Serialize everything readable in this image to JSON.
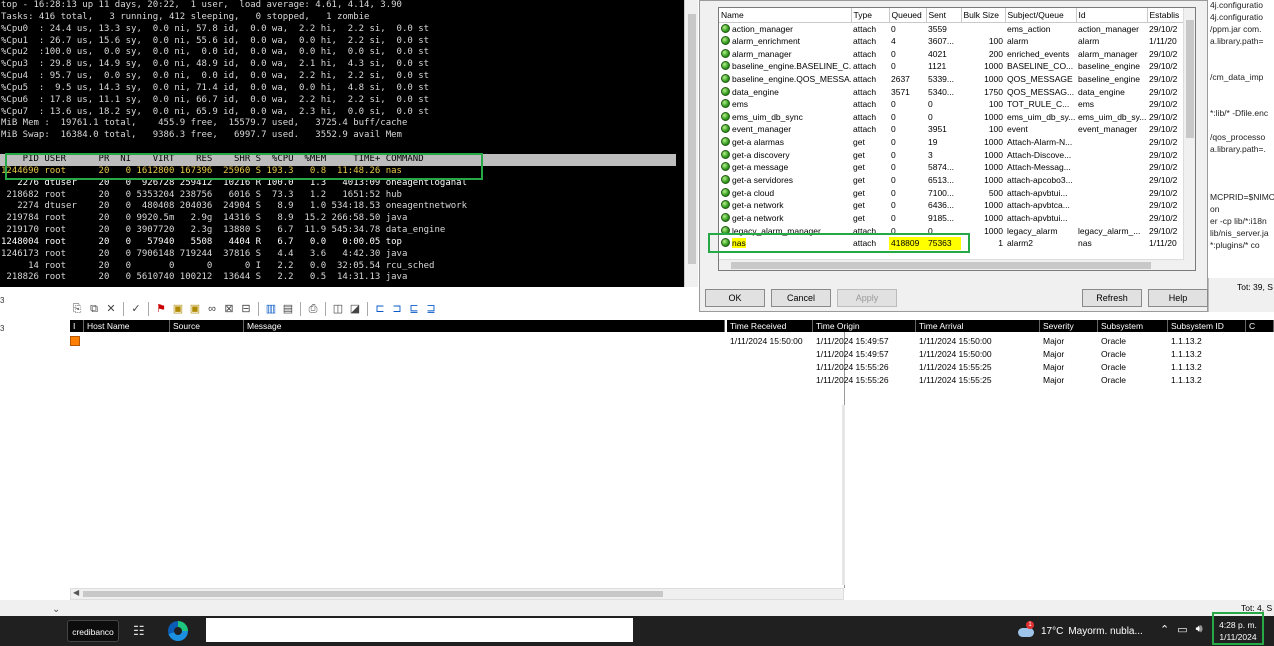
{
  "terminal": {
    "lines": [
      "top - 16:28:13 up 11 days, 20:22,  1 user,  load average: 4.61, 4.14, 3.90",
      "Tasks: 416 total,   3 running, 412 sleeping,   0 stopped,   1 zombie",
      "%Cpu0  : 24.4 us, 13.3 sy,  0.0 ni, 57.8 id,  0.0 wa,  2.2 hi,  2.2 si,  0.0 st",
      "%Cpu1  : 26.7 us, 15.6 sy,  0.0 ni, 55.6 id,  0.0 wa,  0.0 hi,  2.2 si,  0.0 st",
      "%Cpu2  :100.0 us,  0.0 sy,  0.0 ni,  0.0 id,  0.0 wa,  0.0 hi,  0.0 si,  0.0 st",
      "%Cpu3  : 29.8 us, 14.9 sy,  0.0 ni, 48.9 id,  0.0 wa,  2.1 hi,  4.3 si,  0.0 st",
      "%Cpu4  : 95.7 us,  0.0 sy,  0.0 ni,  0.0 id,  0.0 wa,  2.2 hi,  2.2 si,  0.0 st",
      "%Cpu5  :  9.5 us, 14.3 sy,  0.0 ni, 71.4 id,  0.0 wa,  0.0 hi,  4.8 si,  0.0 st",
      "%Cpu6  : 17.8 us, 11.1 sy,  0.0 ni, 66.7 id,  0.0 wa,  2.2 hi,  2.2 si,  0.0 st",
      "%Cpu7  : 13.6 us, 18.2 sy,  0.0 ni, 65.9 id,  0.0 wa,  2.3 hi,  0.0 si,  0.0 st",
      "MiB Mem :  19761.1 total,    455.9 free,  15579.7 used,   3725.4 buff/cache",
      "MiB Swap:  16384.0 total,   9386.3 free,   6997.7 used.   3552.9 avail Mem",
      ""
    ],
    "header": "    PID USER      PR  NI    VIRT    RES    SHR S  %CPU  %MEM     TIME+ COMMAND",
    "processes": [
      {
        "text": "1244690 root      20   0 1612800 167396  25960 S 193.3   0.8  11:48.26 nas",
        "cls": "hot"
      },
      {
        "text": "   2276 dtuser    20   0  926728 259412  10216 R 100.0   1.3   4013:09 oneagentloganal",
        "cls": "bold"
      },
      {
        "text": " 218682 root      20   0 5353204 238756   6016 S  73.3   1.2   1651:52 hub",
        "cls": ""
      },
      {
        "text": "   2274 dtuser    20   0  480408 204036  24904 S   8.9   1.0 534:18.53 oneagentnetwork",
        "cls": ""
      },
      {
        "text": " 219784 root      20   0 9920.5m   2.9g  14316 S   8.9  15.2 266:58.50 java",
        "cls": ""
      },
      {
        "text": " 219170 root      20   0 3907720   2.3g  13880 S   6.7  11.9 545:34.78 data_engine",
        "cls": ""
      },
      {
        "text": "1248004 root      20   0   57940   5508   4404 R   6.7   0.0   0:00.05 top",
        "cls": "bold"
      },
      {
        "text": "1246173 root      20   0 7906148 719244  37816 S   4.4   3.6   4:42.30 java",
        "cls": ""
      },
      {
        "text": "     14 root      20   0       0      0      0 I   2.2   0.0  32:05.54 rcu_sched",
        "cls": ""
      },
      {
        "text": " 218826 root      20   0 5610740 100212  13644 S   2.2   0.5  14:31.13 java",
        "cls": ""
      }
    ]
  },
  "right_snippets": [
    "4j.configuratio",
    "4j.configuratio",
    "/ppm.jar com.",
    "a.library.path=",
    "",
    "",
    "/cm_data_imp",
    "",
    "",
    "*:lib/* -Dfile.enc",
    "",
    "/qos_processo",
    "a.library.path=.",
    "",
    "",
    "",
    "MCPRID=$NIMC",
    "on",
    "er -cp lib/*:i18n",
    "lib/nis_server.ja",
    "*:plugins/* co"
  ],
  "dialog": {
    "columns": [
      "Name",
      "Type",
      "Queued",
      "Sent",
      "Bulk Size",
      "Subject/Queue",
      "Id",
      "Establis"
    ],
    "rows": [
      [
        "action_manager",
        "attach",
        "0",
        "3559",
        "",
        "ems_action",
        "action_manager",
        "29/10/2"
      ],
      [
        "alarm_enrichment",
        "attach",
        "4",
        "3607...",
        "100",
        "alarm",
        "alarm",
        "1/11/20"
      ],
      [
        "alarm_manager",
        "attach",
        "0",
        "4021",
        "200",
        "enriched_events",
        "alarm_manager",
        "29/10/2"
      ],
      [
        "baseline_engine.BASELINE_C...",
        "attach",
        "0",
        "1121",
        "1000",
        "BASELINE_CO...",
        "baseline_engine",
        "29/10/2"
      ],
      [
        "baseline_engine.QOS_MESSA...",
        "attach",
        "2637",
        "5339...",
        "1000",
        "QOS_MESSAGE",
        "baseline_engine",
        "29/10/2"
      ],
      [
        "data_engine",
        "attach",
        "3571",
        "5340...",
        "1750",
        "QOS_MESSAG...",
        "data_engine",
        "29/10/2"
      ],
      [
        "ems",
        "attach",
        "0",
        "0",
        "100",
        "TOT_RULE_C...",
        "ems",
        "29/10/2"
      ],
      [
        "ems_uim_db_sync",
        "attach",
        "0",
        "0",
        "1000",
        "ems_uim_db_sy...",
        "ems_uim_db_sy...",
        "29/10/2"
      ],
      [
        "event_manager",
        "attach",
        "0",
        "3951",
        "100",
        "event",
        "event_manager",
        "29/10/2"
      ],
      [
        "get-a  alarmas",
        "get",
        "0",
        "19",
        "1000",
        "Attach-Alarm-N...",
        "",
        "29/10/2"
      ],
      [
        "get-a  discovery",
        "get",
        "0",
        "3",
        "1000",
        "Attach-Discove...",
        "",
        "29/10/2"
      ],
      [
        "get-a  message",
        "get",
        "0",
        "5874...",
        "1000",
        "Attach-Messag...",
        "",
        "29/10/2"
      ],
      [
        "get-a  servidores",
        "get",
        "0",
        "6513...",
        "1000",
        "attach-apcobo3...",
        "",
        "29/10/2"
      ],
      [
        "get-a  cloud",
        "get",
        "0",
        "7100...",
        "500",
        "attach-apvbtui...",
        "",
        "29/10/2"
      ],
      [
        "get-a  network",
        "get",
        "0",
        "6436...",
        "1000",
        "attach-apvbtca...",
        "",
        "29/10/2"
      ],
      [
        "get-a  network",
        "get",
        "0",
        "9185...",
        "1000",
        "attach-apvbtui...",
        "",
        "29/10/2"
      ],
      [
        "legacy_alarm_manager",
        "attach",
        "0",
        "0",
        "1000",
        "legacy_alarm",
        "legacy_alarm_...",
        "29/10/2"
      ],
      [
        "nas",
        "attach",
        "418809",
        "75363",
        "1",
        "alarm2",
        "nas",
        "1/11/20"
      ],
      [
        "",
        "",
        "",
        "",
        "",
        "",
        "",
        ""
      ]
    ],
    "buttons": {
      "ok": "OK",
      "cancel": "Cancel",
      "apply": "Apply",
      "refresh": "Refresh",
      "help": "Help"
    }
  },
  "right_panel": {
    "tot1": "Tot: 39, S",
    "tot2": "Tot: 4, S"
  },
  "left_edge": [
    "3",
    "3"
  ],
  "alarm_console": {
    "left_headers": [
      "I",
      "Host Name",
      "Source",
      "Message"
    ],
    "right_headers": [
      "Time Received",
      "Time Origin",
      "Time Arrival",
      "Severity",
      "Subsystem",
      "Subsystem ID",
      "C"
    ],
    "rows": [
      [
        "1/11/2024 15:50:00",
        "1/11/2024 15:49:57",
        "1/11/2024 15:50:00",
        "Major",
        "Oracle",
        "1.1.13.2"
      ],
      [
        "",
        "1/11/2024 15:49:57",
        "1/11/2024 15:50:00",
        "Major",
        "Oracle",
        "1.1.13.2"
      ],
      [
        "",
        "1/11/2024 15:55:26",
        "1/11/2024 15:55:25",
        "Major",
        "Oracle",
        "1.1.13.2"
      ],
      [
        "",
        "1/11/2024 15:55:26",
        "1/11/2024 15:55:25",
        "Major",
        "Oracle",
        "1.1.13.2"
      ]
    ]
  },
  "taskbar": {
    "app_label": "credibanco",
    "weather_temp": "17°C",
    "weather_text": "Mayorm. nubla...",
    "weather_badge": "1",
    "time": "4:28 p. m.",
    "date": "1/11/2024"
  }
}
